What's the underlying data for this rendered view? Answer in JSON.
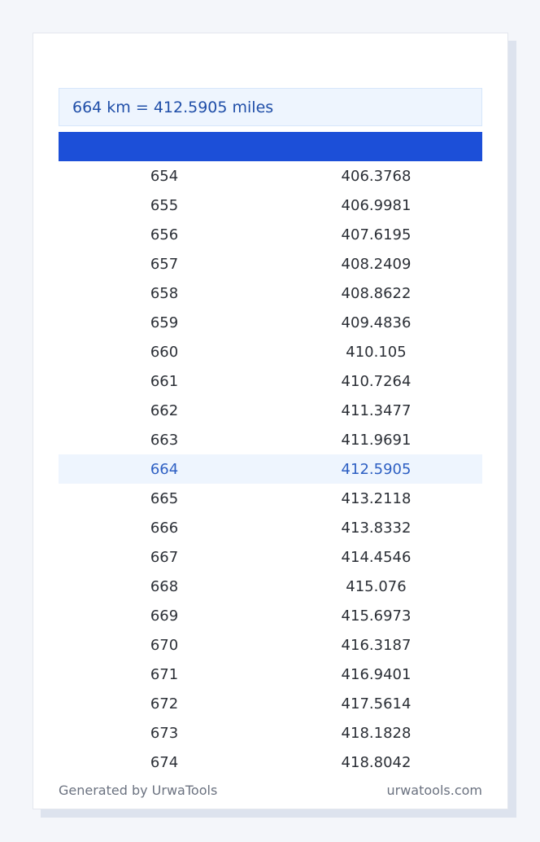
{
  "result": {
    "text": "664 km = 412.5905 miles"
  },
  "table": {
    "highlight_km": "664",
    "rows": [
      {
        "km": "654",
        "miles": "406.3768"
      },
      {
        "km": "655",
        "miles": "406.9981"
      },
      {
        "km": "656",
        "miles": "407.6195"
      },
      {
        "km": "657",
        "miles": "408.2409"
      },
      {
        "km": "658",
        "miles": "408.8622"
      },
      {
        "km": "659",
        "miles": "409.4836"
      },
      {
        "km": "660",
        "miles": "410.105"
      },
      {
        "km": "661",
        "miles": "410.7264"
      },
      {
        "km": "662",
        "miles": "411.3477"
      },
      {
        "km": "663",
        "miles": "411.9691"
      },
      {
        "km": "664",
        "miles": "412.5905"
      },
      {
        "km": "665",
        "miles": "413.2118"
      },
      {
        "km": "666",
        "miles": "413.8332"
      },
      {
        "km": "667",
        "miles": "414.4546"
      },
      {
        "km": "668",
        "miles": "415.076"
      },
      {
        "km": "669",
        "miles": "415.6973"
      },
      {
        "km": "670",
        "miles": "416.3187"
      },
      {
        "km": "671",
        "miles": "416.9401"
      },
      {
        "km": "672",
        "miles": "417.5614"
      },
      {
        "km": "673",
        "miles": "418.1828"
      },
      {
        "km": "674",
        "miles": "418.8042"
      }
    ]
  },
  "footer": {
    "left": "Generated by UrwaTools",
    "right": "urwatools.com"
  },
  "colors": {
    "header": "#1c4fd8",
    "highlight_bg": "#eef5fe",
    "highlight_text": "#2d5fc3"
  }
}
